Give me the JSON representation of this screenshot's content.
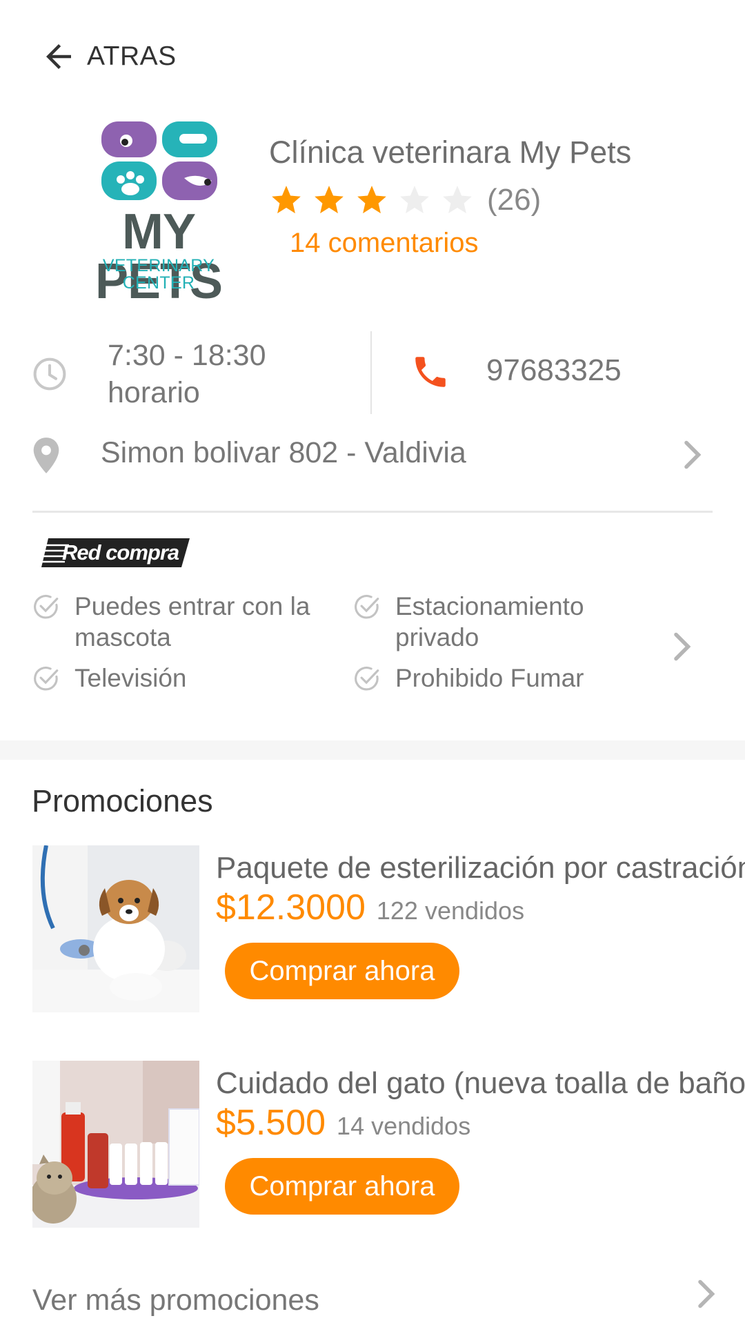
{
  "header": {
    "back_label": "ATRAS"
  },
  "clinic": {
    "logo_text": "MY PETS",
    "logo_subtext": "VETERINARY CENTER",
    "name": "Clínica veterinara My Pets",
    "rating": 3,
    "rating_max": 5,
    "rating_count": "(26)",
    "comments": "14 comentarios"
  },
  "info": {
    "hours": "7:30 - 18:30",
    "hours_label": "horario",
    "phone": "97683325",
    "address": "Simon bolivar 802 - Valdivia"
  },
  "payment_badge": "Red compra",
  "amenities": [
    "Puedes entrar con la mascota",
    "Estacionamiento privado",
    "Televisión",
    "Prohibido Fumar"
  ],
  "promotions": {
    "title": "Promociones",
    "items": [
      {
        "name": "Paquete de esterilización por castración",
        "price": "$12.3000",
        "sold": "122 vendidos",
        "button": "Comprar ahora"
      },
      {
        "name": "Cuidado del gato (nueva toalla de baño)",
        "price": "$5.500",
        "sold": "14 vendidos",
        "button": "Comprar ahora"
      }
    ],
    "more_label": "Ver más promociones"
  },
  "colors": {
    "accent": "#ff8a00",
    "phone_icon": "#f4511e",
    "star_on": "#ff9800",
    "star_off": "#eeeeee"
  },
  "icons": [
    "back-arrow-icon",
    "clock-icon",
    "phone-icon",
    "location-pin-icon",
    "chevron-right-icon",
    "check-circle-icon",
    "star-icon"
  ]
}
